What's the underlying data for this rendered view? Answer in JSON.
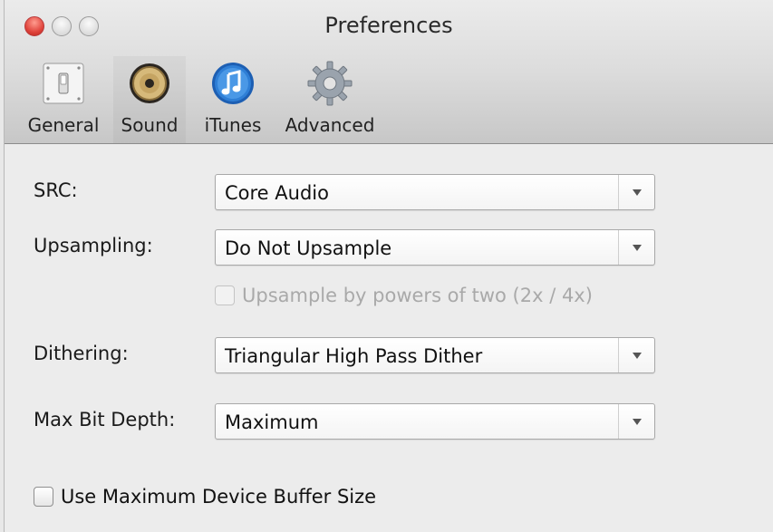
{
  "window": {
    "title": "Preferences",
    "controls": [
      "close",
      "minimize",
      "zoom"
    ]
  },
  "toolbar": {
    "items": [
      {
        "label": "General",
        "icon": "general-switch-icon"
      },
      {
        "label": "Sound",
        "icon": "speaker-icon"
      },
      {
        "label": "iTunes",
        "icon": "itunes-note-icon"
      },
      {
        "label": "Advanced",
        "icon": "gear-icon"
      }
    ],
    "selected": "Sound"
  },
  "settings": {
    "src": {
      "label": "SRC:",
      "value": "Core Audio"
    },
    "upsampling": {
      "label": "Upsampling:",
      "value": "Do Not Upsample"
    },
    "powers_of_two": {
      "label": "Upsample by powers of two (2x / 4x)",
      "checked": false,
      "enabled": false
    },
    "dithering": {
      "label": "Dithering:",
      "value": "Triangular High Pass Dither"
    },
    "max_bit_depth": {
      "label": "Max Bit Depth:",
      "value": "Maximum"
    },
    "max_buffer": {
      "label": "Use Maximum Device Buffer Size",
      "checked": false,
      "enabled": true
    }
  },
  "colors": {
    "close_button": "#e0443c",
    "itunes_blue": "#2f7fd6",
    "disabled_text": "#a9a9a9"
  }
}
